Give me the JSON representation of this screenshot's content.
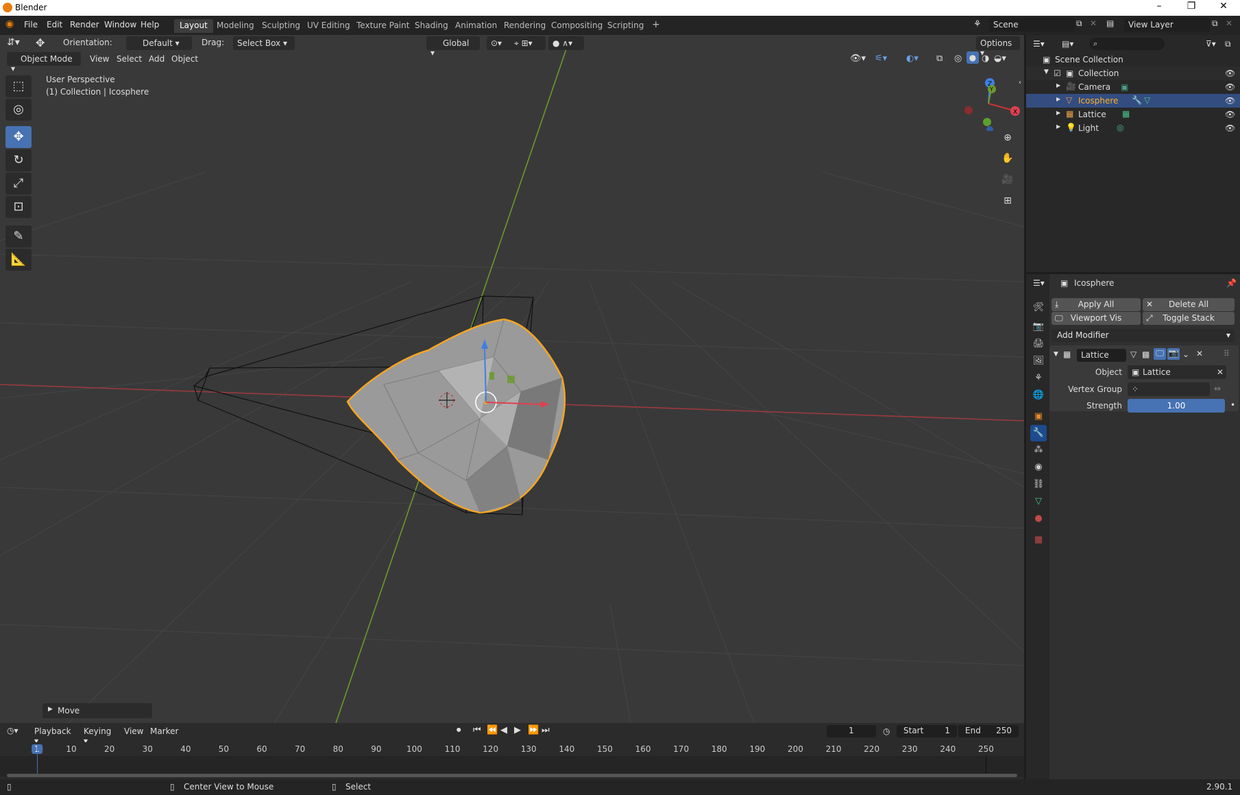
{
  "window": {
    "title": "Blender",
    "minimize": "–",
    "maximize": "❐",
    "close": "✕"
  },
  "menu": {
    "file": "File",
    "edit": "Edit",
    "render": "Render",
    "window": "Window",
    "help": "Help"
  },
  "workspaces": [
    "Layout",
    "Modeling",
    "Sculpting",
    "UV Editing",
    "Texture Paint",
    "Shading",
    "Animation",
    "Rendering",
    "Compositing",
    "Scripting"
  ],
  "workspace_add": "+",
  "scene": {
    "name": "Scene",
    "view_layer": "View Layer"
  },
  "tool_header": {
    "orientation_label": "Orientation:",
    "orientation_value": "Default",
    "drag_label": "Drag:",
    "drag_value": "Select Box",
    "transform_orientation": "Global",
    "options": "Options"
  },
  "viewport_header": {
    "mode": "Object Mode",
    "view": "View",
    "select": "Select",
    "add": "Add",
    "object": "Object"
  },
  "viewport": {
    "perspective": "User Perspective",
    "context": "(1) Collection | Icosphere",
    "last_op": "Move",
    "gizmo": {
      "x": "X",
      "y": "Y",
      "z": "Z"
    }
  },
  "outliner": {
    "search_placeholder": "",
    "root": "Scene Collection",
    "collection": "Collection",
    "items": [
      {
        "name": "Camera",
        "color": "#e6a04a"
      },
      {
        "name": "Icosphere",
        "color": "#e6a04a"
      },
      {
        "name": "Lattice",
        "color": "#e6a04a"
      },
      {
        "name": "Light",
        "color": "#e6a04a"
      }
    ]
  },
  "properties": {
    "object_name": "Icosphere",
    "apply_all": "Apply All",
    "delete_all": "Delete All",
    "viewport_vis": "Viewport Vis",
    "toggle_stack": "Toggle Stack",
    "add_modifier": "Add Modifier",
    "modifier": {
      "name": "Lattice",
      "object_label": "Object",
      "object_value": "Lattice",
      "vertex_group_label": "Vertex Group",
      "vertex_group_value": "",
      "strength_label": "Strength",
      "strength_value": "1.00"
    }
  },
  "timeline": {
    "playback": "Playback",
    "keying": "Keying",
    "view": "View",
    "marker": "Marker",
    "current_frame": "1",
    "start_label": "Start",
    "start_value": "1",
    "end_label": "End",
    "end_value": "250",
    "ruler": [
      "1",
      "10",
      "20",
      "30",
      "40",
      "50",
      "60",
      "70",
      "80",
      "90",
      "100",
      "110",
      "120",
      "130",
      "140",
      "150",
      "160",
      "170",
      "180",
      "190",
      "200",
      "210",
      "220",
      "230",
      "240",
      "250"
    ]
  },
  "status": {
    "center_view": "Center View to Mouse",
    "select": "Select",
    "version": "2.90.1"
  },
  "colors": {
    "accent": "#4772b3",
    "selection_outline": "#f5a623",
    "x_axis": "#c0393b",
    "y_axis": "#6a9a2c"
  }
}
